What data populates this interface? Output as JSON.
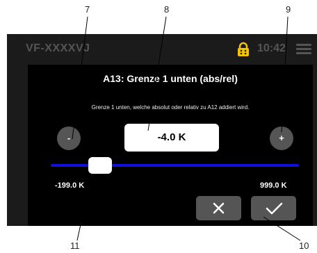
{
  "statusbar": {
    "device_name": "VF-XXXXVJ",
    "time": "10:42",
    "icons": {
      "lock": "lock-icon",
      "menu": "hamburger-menu-icon"
    }
  },
  "dialog": {
    "title": "A13: Grenze 1 unten (abs/rel)",
    "description": "Grenze 1 unten, welche absolut oder relativ zu A12 addiert wird.",
    "minus_label": "-",
    "plus_label": "+",
    "value": "-4.0 K",
    "slider": {
      "min_label": "-199.0 K",
      "max_label": "999.0 K"
    },
    "cancel_icon": "close-icon",
    "confirm_icon": "check-icon"
  },
  "callouts": {
    "c7": "7",
    "c8": "8",
    "c9": "9",
    "c10": "10",
    "c11": "11"
  },
  "colors": {
    "accent_lock": "#f5c400",
    "slider_track": "#1010dd",
    "button_gray": "#555555",
    "dialog_bg": "#000000",
    "frame_bg": "#1b1b1b"
  }
}
